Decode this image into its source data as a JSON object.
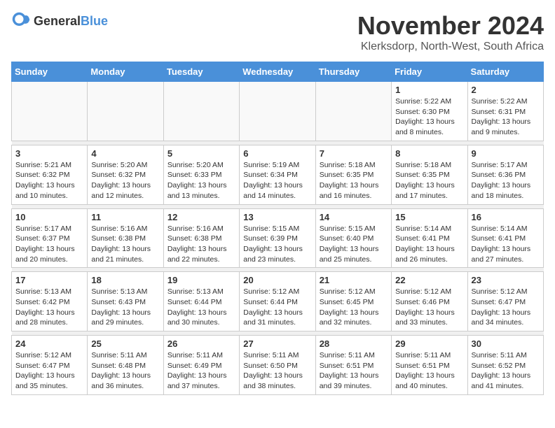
{
  "logo": {
    "text1": "General",
    "text2": "Blue"
  },
  "title": "November 2024",
  "location": "Klerksdorp, North-West, South Africa",
  "weekdays": [
    "Sunday",
    "Monday",
    "Tuesday",
    "Wednesday",
    "Thursday",
    "Friday",
    "Saturday"
  ],
  "weeks": [
    [
      {
        "day": "",
        "info": ""
      },
      {
        "day": "",
        "info": ""
      },
      {
        "day": "",
        "info": ""
      },
      {
        "day": "",
        "info": ""
      },
      {
        "day": "",
        "info": ""
      },
      {
        "day": "1",
        "info": "Sunrise: 5:22 AM\nSunset: 6:30 PM\nDaylight: 13 hours and 8 minutes."
      },
      {
        "day": "2",
        "info": "Sunrise: 5:22 AM\nSunset: 6:31 PM\nDaylight: 13 hours and 9 minutes."
      }
    ],
    [
      {
        "day": "3",
        "info": "Sunrise: 5:21 AM\nSunset: 6:32 PM\nDaylight: 13 hours and 10 minutes."
      },
      {
        "day": "4",
        "info": "Sunrise: 5:20 AM\nSunset: 6:32 PM\nDaylight: 13 hours and 12 minutes."
      },
      {
        "day": "5",
        "info": "Sunrise: 5:20 AM\nSunset: 6:33 PM\nDaylight: 13 hours and 13 minutes."
      },
      {
        "day": "6",
        "info": "Sunrise: 5:19 AM\nSunset: 6:34 PM\nDaylight: 13 hours and 14 minutes."
      },
      {
        "day": "7",
        "info": "Sunrise: 5:18 AM\nSunset: 6:35 PM\nDaylight: 13 hours and 16 minutes."
      },
      {
        "day": "8",
        "info": "Sunrise: 5:18 AM\nSunset: 6:35 PM\nDaylight: 13 hours and 17 minutes."
      },
      {
        "day": "9",
        "info": "Sunrise: 5:17 AM\nSunset: 6:36 PM\nDaylight: 13 hours and 18 minutes."
      }
    ],
    [
      {
        "day": "10",
        "info": "Sunrise: 5:17 AM\nSunset: 6:37 PM\nDaylight: 13 hours and 20 minutes."
      },
      {
        "day": "11",
        "info": "Sunrise: 5:16 AM\nSunset: 6:38 PM\nDaylight: 13 hours and 21 minutes."
      },
      {
        "day": "12",
        "info": "Sunrise: 5:16 AM\nSunset: 6:38 PM\nDaylight: 13 hours and 22 minutes."
      },
      {
        "day": "13",
        "info": "Sunrise: 5:15 AM\nSunset: 6:39 PM\nDaylight: 13 hours and 23 minutes."
      },
      {
        "day": "14",
        "info": "Sunrise: 5:15 AM\nSunset: 6:40 PM\nDaylight: 13 hours and 25 minutes."
      },
      {
        "day": "15",
        "info": "Sunrise: 5:14 AM\nSunset: 6:41 PM\nDaylight: 13 hours and 26 minutes."
      },
      {
        "day": "16",
        "info": "Sunrise: 5:14 AM\nSunset: 6:41 PM\nDaylight: 13 hours and 27 minutes."
      }
    ],
    [
      {
        "day": "17",
        "info": "Sunrise: 5:13 AM\nSunset: 6:42 PM\nDaylight: 13 hours and 28 minutes."
      },
      {
        "day": "18",
        "info": "Sunrise: 5:13 AM\nSunset: 6:43 PM\nDaylight: 13 hours and 29 minutes."
      },
      {
        "day": "19",
        "info": "Sunrise: 5:13 AM\nSunset: 6:44 PM\nDaylight: 13 hours and 30 minutes."
      },
      {
        "day": "20",
        "info": "Sunrise: 5:12 AM\nSunset: 6:44 PM\nDaylight: 13 hours and 31 minutes."
      },
      {
        "day": "21",
        "info": "Sunrise: 5:12 AM\nSunset: 6:45 PM\nDaylight: 13 hours and 32 minutes."
      },
      {
        "day": "22",
        "info": "Sunrise: 5:12 AM\nSunset: 6:46 PM\nDaylight: 13 hours and 33 minutes."
      },
      {
        "day": "23",
        "info": "Sunrise: 5:12 AM\nSunset: 6:47 PM\nDaylight: 13 hours and 34 minutes."
      }
    ],
    [
      {
        "day": "24",
        "info": "Sunrise: 5:12 AM\nSunset: 6:47 PM\nDaylight: 13 hours and 35 minutes."
      },
      {
        "day": "25",
        "info": "Sunrise: 5:11 AM\nSunset: 6:48 PM\nDaylight: 13 hours and 36 minutes."
      },
      {
        "day": "26",
        "info": "Sunrise: 5:11 AM\nSunset: 6:49 PM\nDaylight: 13 hours and 37 minutes."
      },
      {
        "day": "27",
        "info": "Sunrise: 5:11 AM\nSunset: 6:50 PM\nDaylight: 13 hours and 38 minutes."
      },
      {
        "day": "28",
        "info": "Sunrise: 5:11 AM\nSunset: 6:51 PM\nDaylight: 13 hours and 39 minutes."
      },
      {
        "day": "29",
        "info": "Sunrise: 5:11 AM\nSunset: 6:51 PM\nDaylight: 13 hours and 40 minutes."
      },
      {
        "day": "30",
        "info": "Sunrise: 5:11 AM\nSunset: 6:52 PM\nDaylight: 13 hours and 41 minutes."
      }
    ]
  ]
}
